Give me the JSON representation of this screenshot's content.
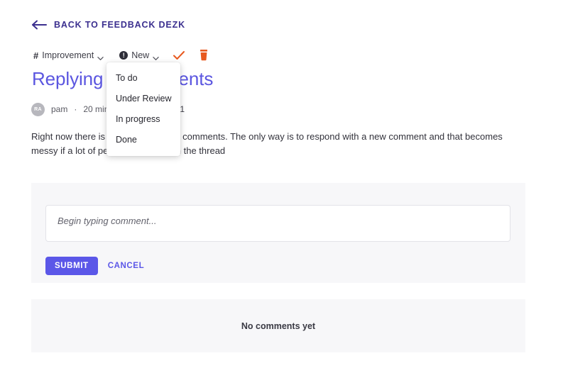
{
  "nav": {
    "back_label": "BACK TO FEEDBACK DEZK",
    "back_icon": "arrow-left-icon"
  },
  "toolbar": {
    "category": {
      "icon": "hash-icon",
      "icon_glyph": "#",
      "label": "Improvement",
      "chevron_icon": "chevron-down-icon"
    },
    "status": {
      "icon": "info-circle-icon",
      "icon_glyph": "!",
      "label": "New",
      "chevron_icon": "chevron-down-icon"
    },
    "approve_icon": "check-icon",
    "delete_icon": "trash-icon"
  },
  "status_dropdown": {
    "open": true,
    "options": [
      "To do",
      "Under Review",
      "In progress",
      "Done"
    ]
  },
  "post": {
    "title": "Replying to comments",
    "author_initials": "RA",
    "author": "pam",
    "separator": "·",
    "time": "20 minutes ago",
    "comment_icon": "comment-icon",
    "comment_count": "1",
    "body": "Right now there is no way to reply to comments. The only way is to respond with a new comment and that becomes messy if a lot of people are active on the thread"
  },
  "comment_form": {
    "placeholder": "Begin typing comment...",
    "value": "",
    "submit_label": "SUBMIT",
    "cancel_label": "CANCEL"
  },
  "comments_section": {
    "empty_label": "No comments yet"
  },
  "colors": {
    "accent_purple": "#5B57E8",
    "title_purple": "#5B56E0",
    "back_navy": "#3B2F8F",
    "orange": "#E8591F",
    "panel_bg": "#F7F7F9"
  }
}
